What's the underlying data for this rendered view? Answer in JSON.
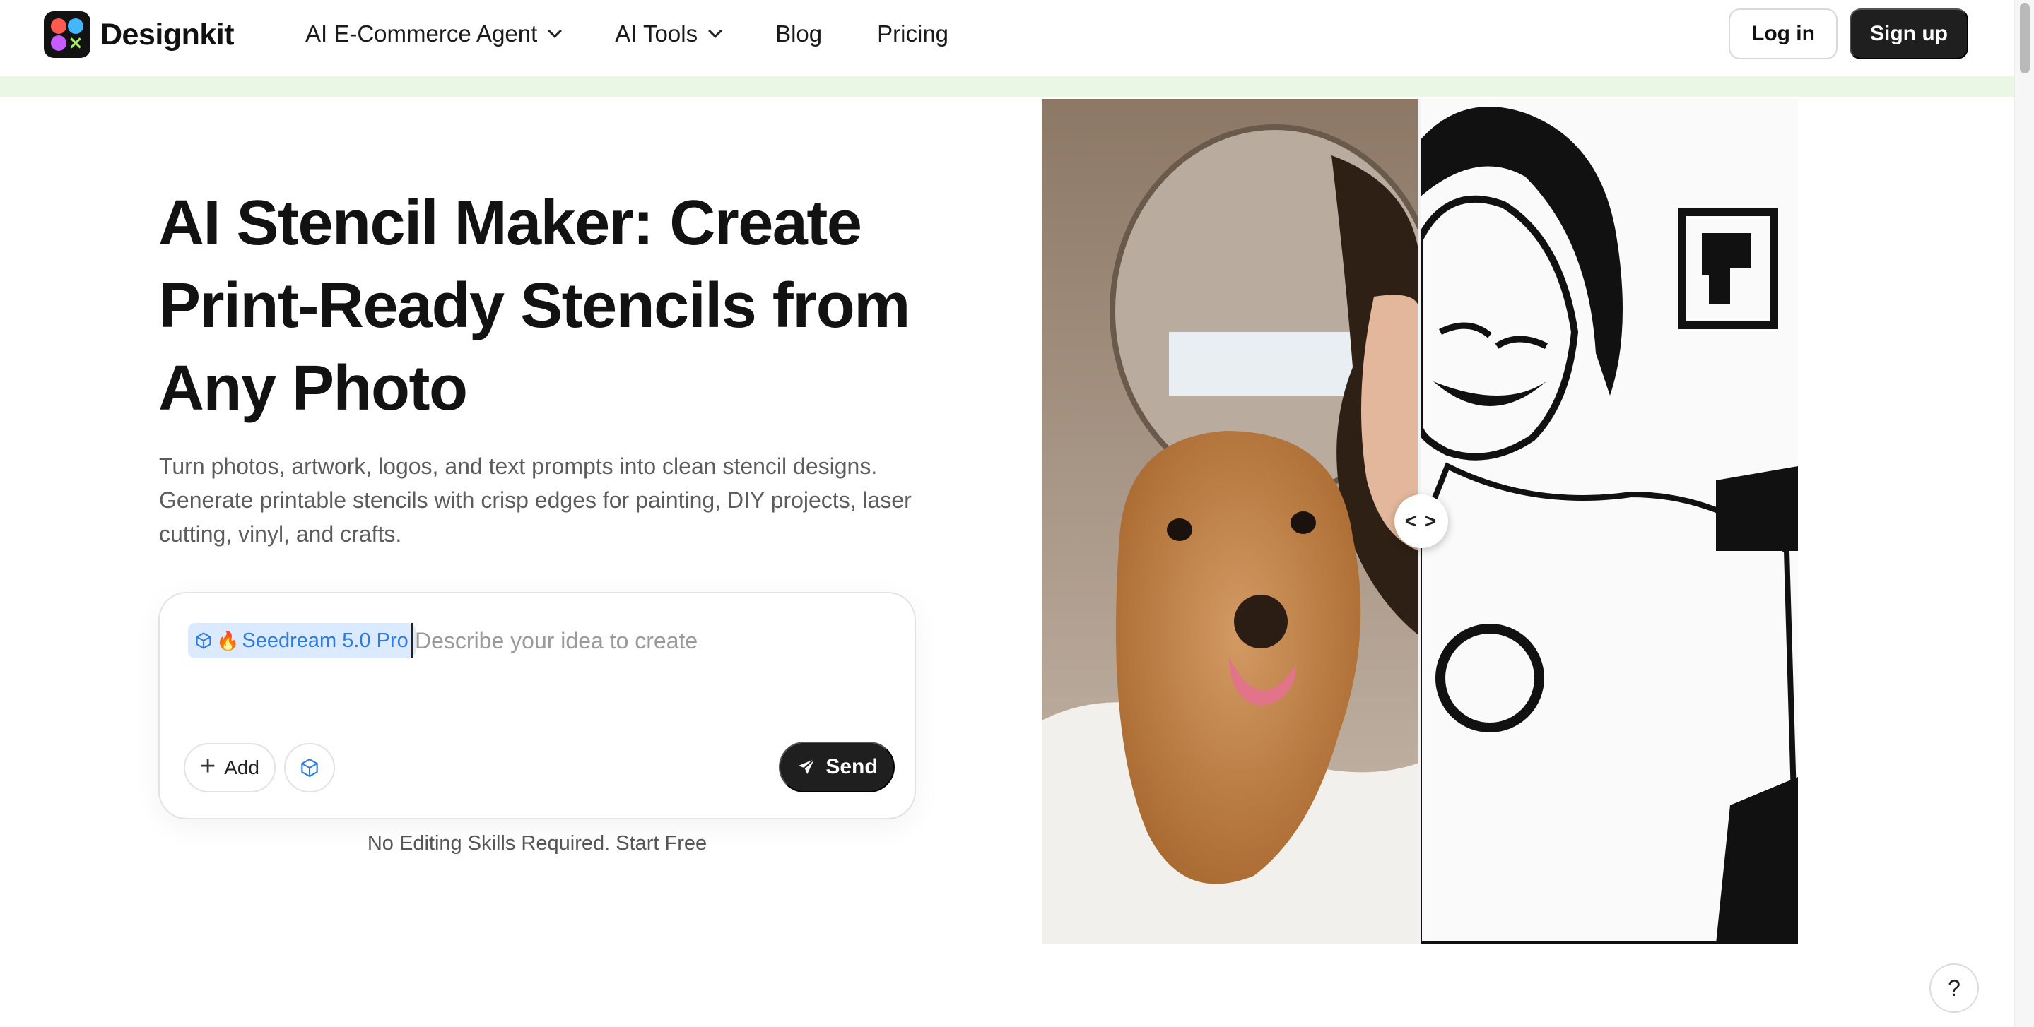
{
  "brand": {
    "name": "Designkit"
  },
  "nav": {
    "items": [
      {
        "label": "AI E-Commerce Agent",
        "dropdown": true
      },
      {
        "label": "AI Tools",
        "dropdown": true
      },
      {
        "label": "Blog",
        "dropdown": false
      },
      {
        "label": "Pricing",
        "dropdown": false
      }
    ],
    "login": "Log in",
    "signup": "Sign up"
  },
  "hero": {
    "title": "AI Stencil Maker: Create Print-Ready Stencils from Any Photo",
    "subtitle": "Turn photos, artwork, logos, and text prompts into clean stencil designs. Generate printable stencils with crisp edges for painting, DIY projects, laser cutting, vinyl, and crafts."
  },
  "prompt": {
    "model_chip": "Seedream 5.0 Pro",
    "placeholder": "Describe your idea to create",
    "value": "",
    "add_label": "Add",
    "send_label": "Send",
    "note": "No Editing Skills Required. Start Free"
  },
  "compare": {
    "handle_glyph": "< >"
  },
  "help": {
    "label": "?"
  },
  "icons": {
    "model_chip": [
      "cube-icon",
      "fire-icon"
    ],
    "add": "plus-icon",
    "model_button": "cube-icon",
    "send": "paper-plane-icon",
    "nav_dropdown": "chevron-down-icon"
  },
  "colors": {
    "accent_blue": "#2c7be5",
    "chip_bg": "#dbeaff",
    "dark_button": "#1f1f1f",
    "band": "#eaf7e4"
  }
}
